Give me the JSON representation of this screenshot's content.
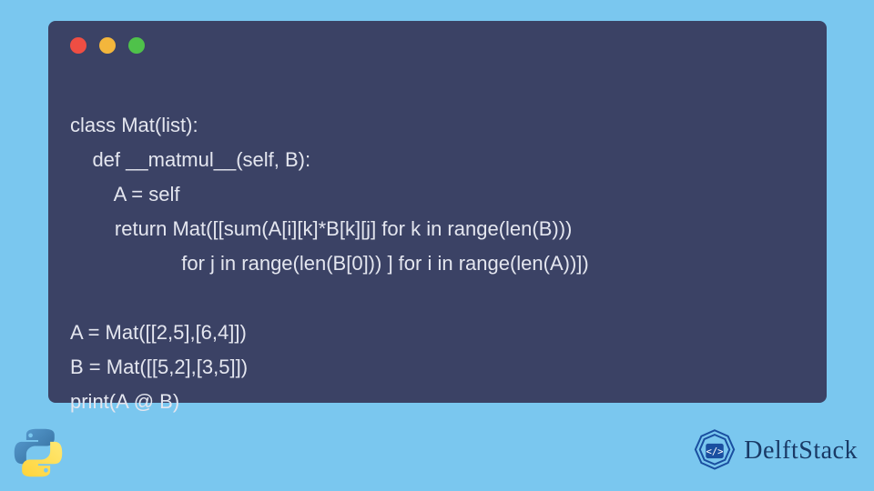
{
  "code": {
    "lines": [
      "class Mat(list):",
      "    def __matmul__(self, B):",
      "        A = self",
      "        return Mat([[sum(A[i][k]*B[k][j] for k in range(len(B)))",
      "                    for j in range(len(B[0])) ] for i in range(len(A))])",
      "",
      "A = Mat([[2,5],[6,4]])",
      "B = Mat([[5,2],[3,5]])",
      "print(A @ B)"
    ]
  },
  "window": {
    "dots": {
      "red": "red-dot",
      "yellow": "yellow-dot",
      "green": "green-dot"
    }
  },
  "branding": {
    "site_name": "DelftStack"
  }
}
